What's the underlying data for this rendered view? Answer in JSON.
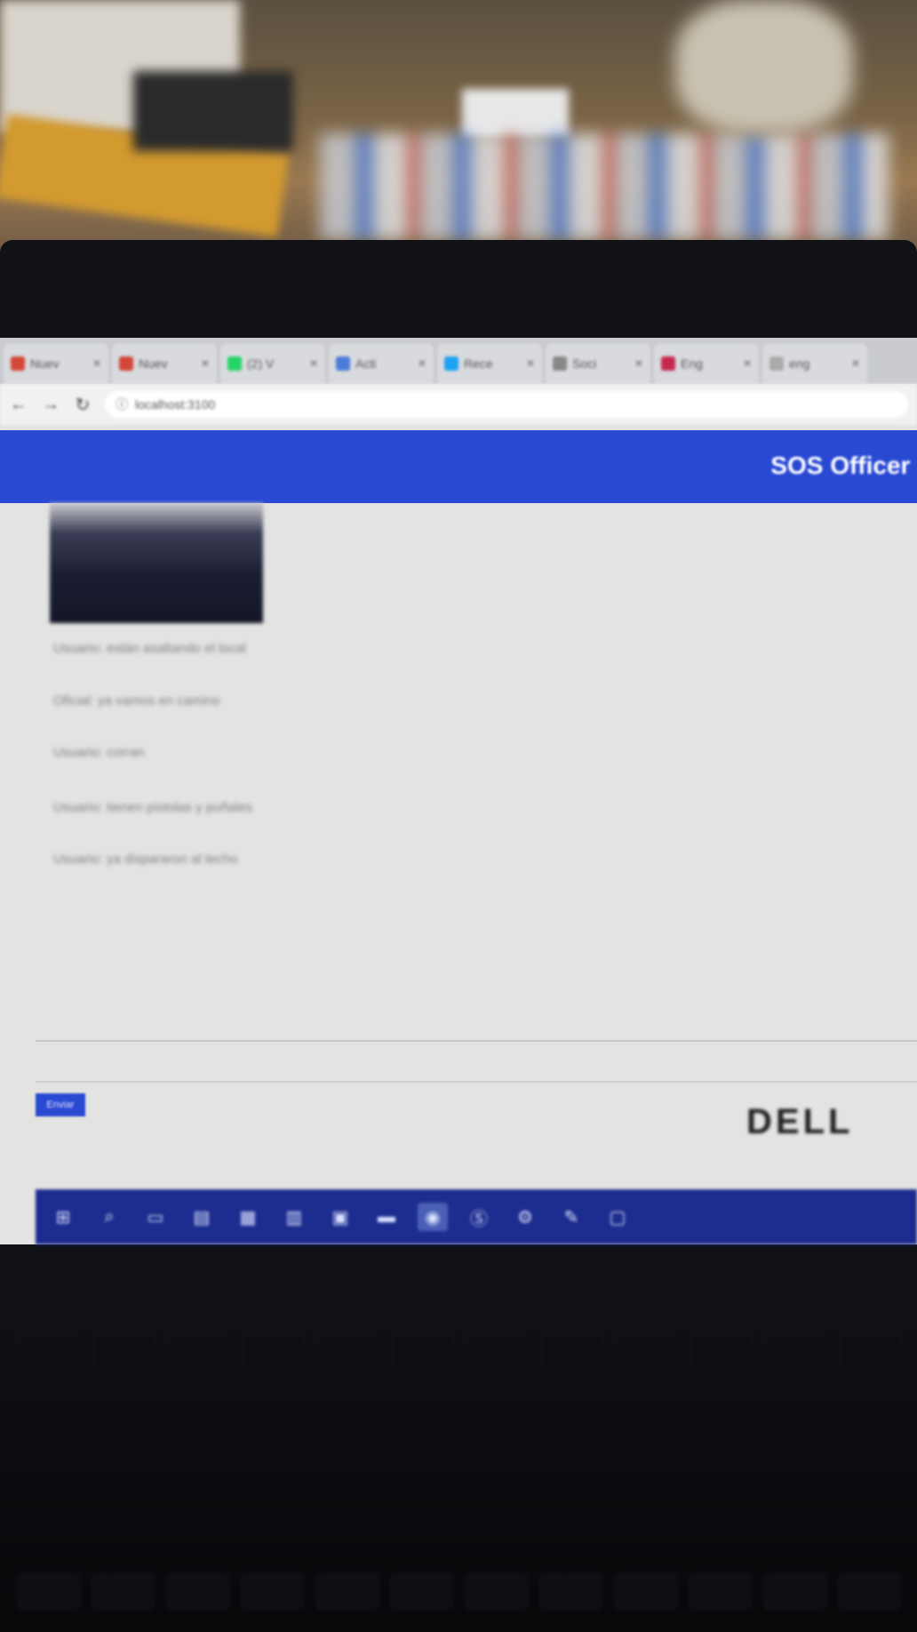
{
  "browser": {
    "tabs": [
      {
        "label": "Nuev",
        "icon": "gmail-icon",
        "color": "#d44638"
      },
      {
        "label": "Nuev",
        "icon": "gmail-icon",
        "color": "#d44638"
      },
      {
        "label": "(2) V",
        "icon": "whatsapp-icon",
        "color": "#25d366"
      },
      {
        "label": "Acti",
        "icon": "page-icon",
        "color": "#4a7bd8"
      },
      {
        "label": "Rece",
        "icon": "bird-icon",
        "color": "#1da1f2"
      },
      {
        "label": "Soci",
        "icon": "doc-icon",
        "color": "#888888"
      },
      {
        "label": "Eng",
        "icon": "pin-icon",
        "color": "#c6284d"
      },
      {
        "label": "eng",
        "icon": "page-icon",
        "color": "#aaaaaa"
      }
    ],
    "address": "localhost:3100"
  },
  "app": {
    "title": "SOS Officer I",
    "accent": "#2a49d3"
  },
  "messages": [
    "Usuario: están asaltando el local",
    "Oficial: ya vamos en camino",
    "Usuario: corran",
    "Usuario: tienen pistolas y puñales",
    "Usuario: ya dispararon al techo"
  ],
  "composer": {
    "send_label": "Enviar"
  },
  "taskbar": {
    "items": [
      "windows-icon",
      "search-icon",
      "task-view-icon",
      "file-explorer-icon",
      "notes-icon",
      "calculator-icon",
      "folder-icon",
      "terminal-icon",
      "chrome-icon",
      "skype-icon",
      "settings-icon",
      "paint-icon",
      "store-icon"
    ],
    "active_index": 8
  },
  "device": {
    "brand": "DELL"
  }
}
